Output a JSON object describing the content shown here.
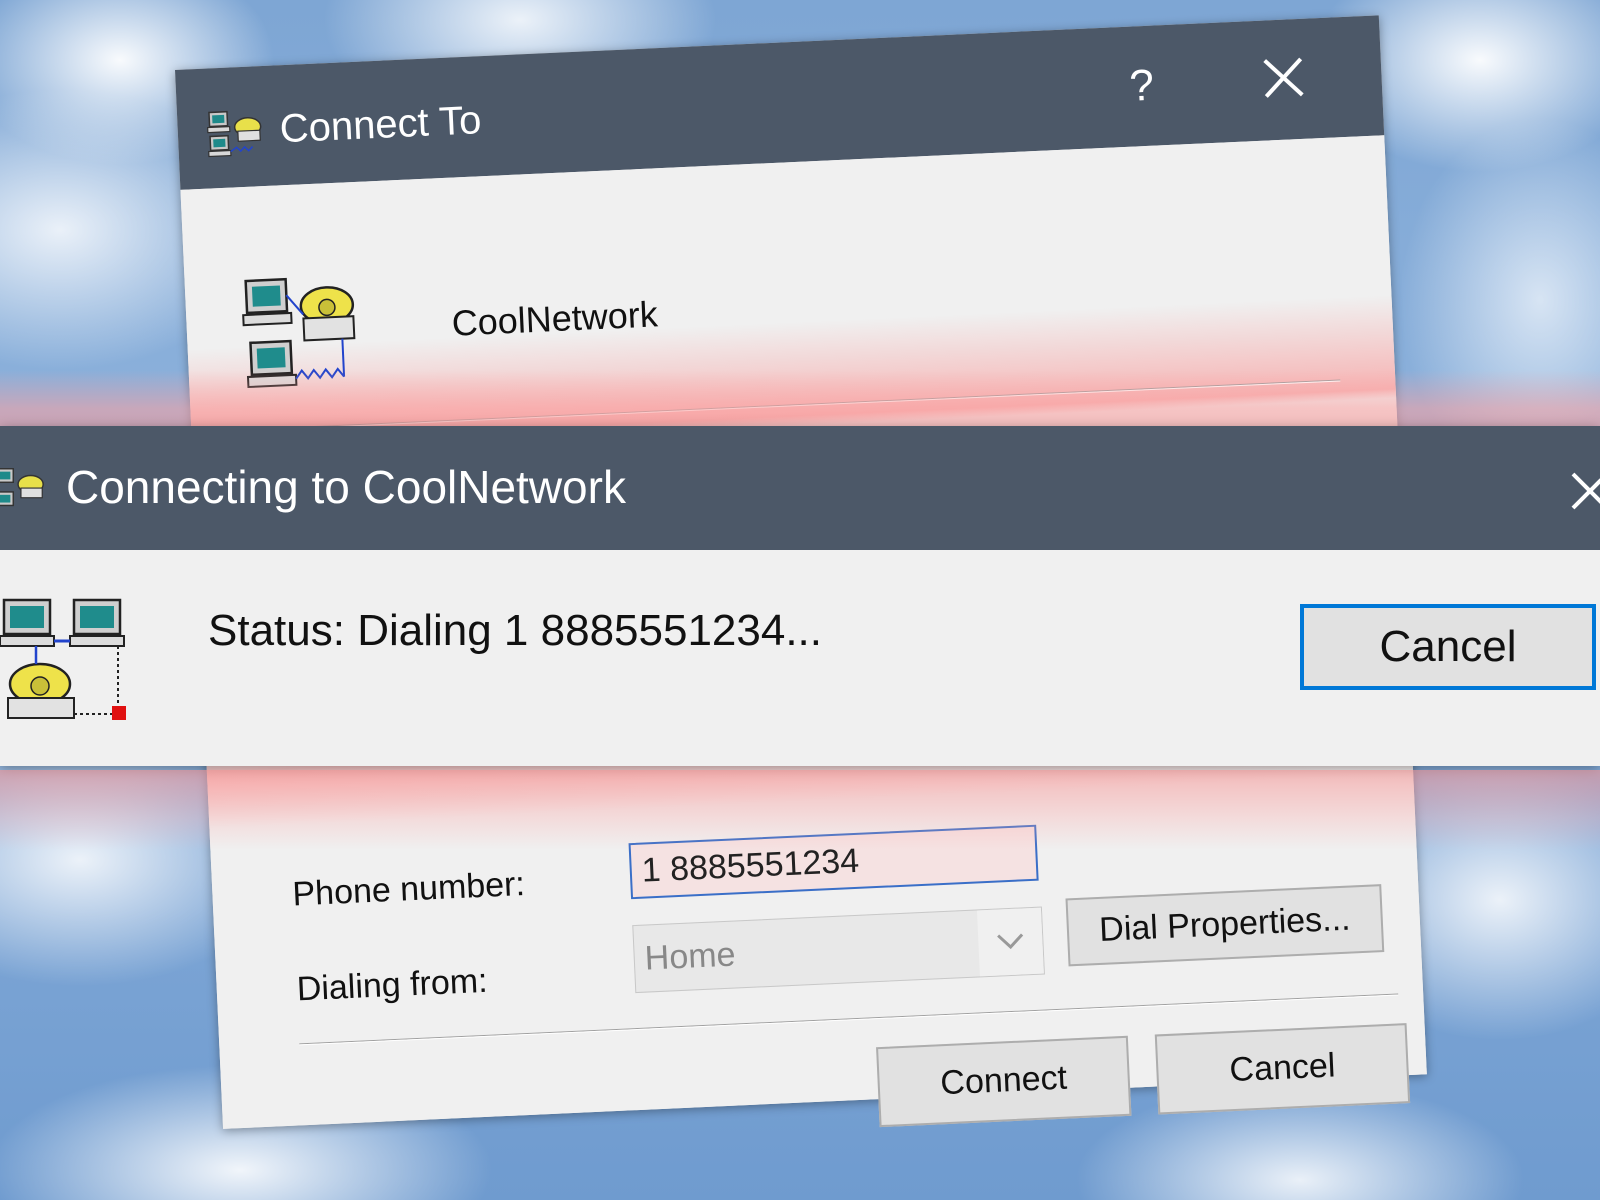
{
  "connect_to_dialog": {
    "title": "Connect To",
    "help_label": "?",
    "entry_name": "CoolNetwork",
    "phone_label": "Phone number:",
    "phone_value": "1 8885551234",
    "dialing_from_label": "Dialing from:",
    "dialing_from_value": "Home",
    "dial_properties_label": "Dial Properties...",
    "connect_label": "Connect",
    "cancel_label": "Cancel"
  },
  "connecting_dialog": {
    "title": "Connecting to CoolNetwork",
    "status": "Status: Dialing 1 8885551234...",
    "cancel_label": "Cancel"
  },
  "colors": {
    "titlebar": "#4c5868",
    "dialog_bg": "#f0f0f0",
    "focus_border": "#0078d7"
  },
  "icons": {
    "connect_to_title": "network-phone-icon",
    "entry": "dialup-network-icon",
    "connecting_status": "dialing-computers-icon"
  }
}
